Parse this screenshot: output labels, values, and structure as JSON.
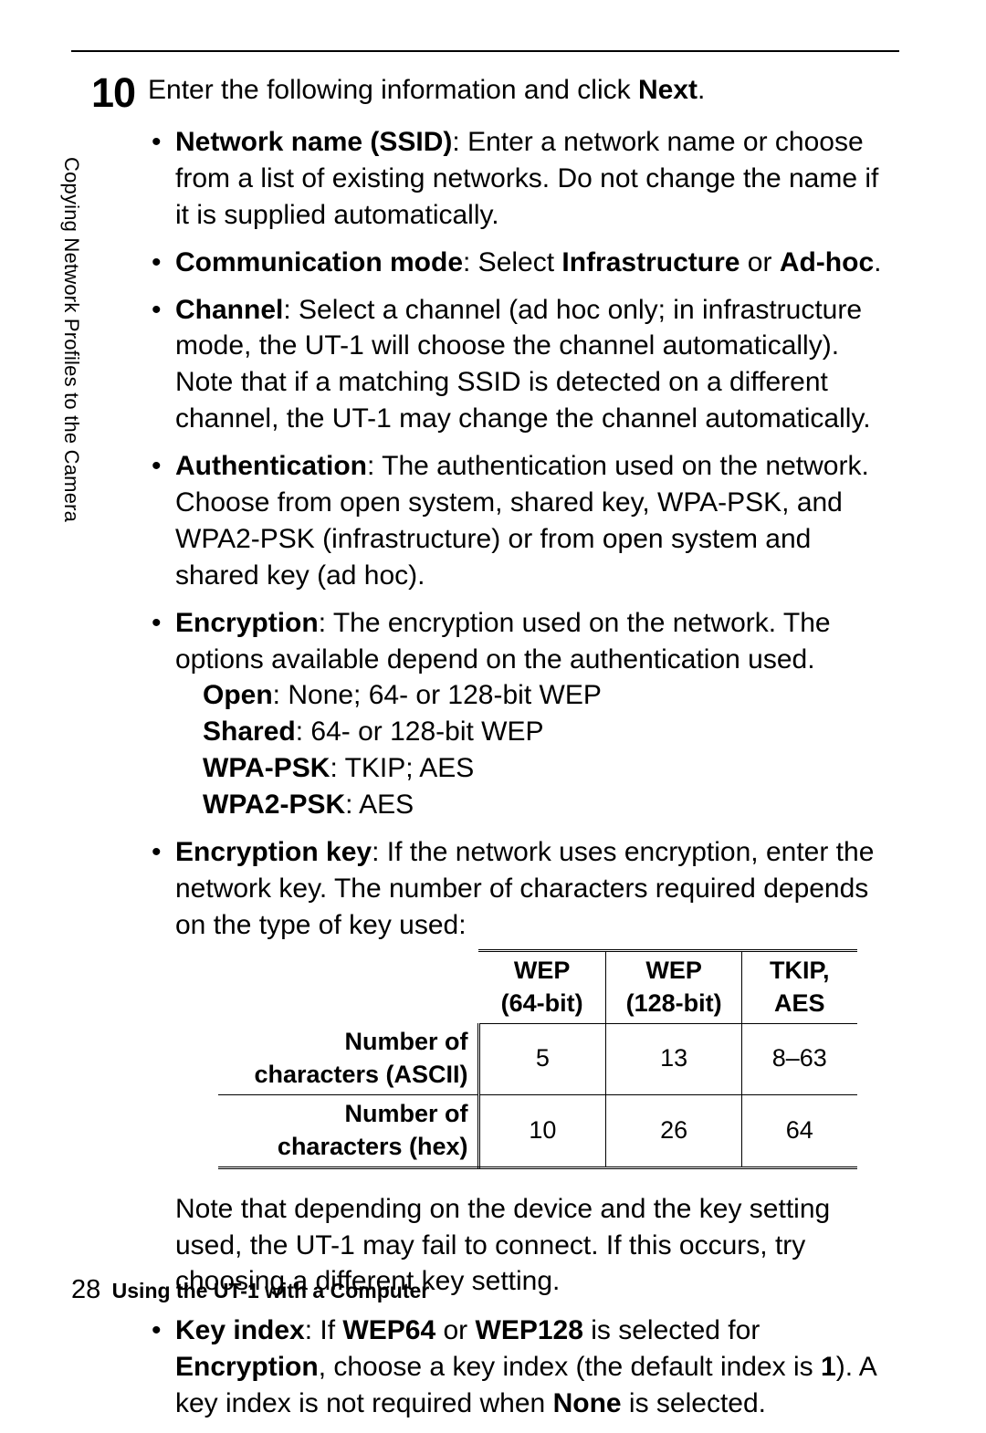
{
  "side_tab": "Copying Network Profiles to the Camera",
  "step_number": "10",
  "intro_pre": "Enter the following information and click ",
  "intro_bold": "Next",
  "intro_post": ".",
  "items": {
    "ssid": {
      "label": "Network name (SSID)",
      "text": ": Enter a network name or choose from a list of existing networks.  Do not change the name if it is supplied automatically."
    },
    "comm_mode": {
      "label": "Communication mode",
      "pre": ": Select ",
      "opt1": "Infrastructure",
      "mid": " or ",
      "opt2": "Ad-hoc",
      "post": "."
    },
    "channel": {
      "label": "Channel",
      "text": ": Select a channel (ad hoc only; in infrastructure mode, the UT-1 will choose the channel automatically). Note that if a matching SSID is detected on a different channel, the UT-1 may change the channel automatically."
    },
    "auth": {
      "label": "Authentication",
      "text": ": The authentication used on the network. Choose from open system, shared key, WPA-PSK, and WPA2-PSK (infrastructure) or from open system and shared key (ad hoc)."
    },
    "encryption": {
      "label": "Encryption",
      "text": ": The encryption used on the network. The options available depend on the authentication used.",
      "sub": {
        "open_l": "Open",
        "open_t": ": None; 64- or 128-bit WEP",
        "shared_l": "Shared",
        "shared_t": ": 64- or 128-bit WEP",
        "wpa_l": "WPA-PSK",
        "wpa_t": ": TKIP; AES",
        "wpa2_l": "WPA2-PSK",
        "wpa2_t": ": AES"
      }
    },
    "enckey": {
      "label": "Encryption key",
      "text": ": If the network uses encryption, enter the network key.  The number of characters required depends on the type of key used:"
    },
    "note_after": "Note that depending on the device and the key setting used, the UT-1 may fail to connect. If this occurs, try choosing a different key setting.",
    "keyindex": {
      "label": "Key index",
      "p1": ": If ",
      "w64": "WEP64",
      "p2": " or ",
      "w128": "WEP128",
      "p3": " is selected for ",
      "enc": "Encryption",
      "p4": ", choose a key index (the default index is ",
      "one": "1",
      "p5": "). A key index is not required when ",
      "none": "None",
      "p6": " is selected."
    }
  },
  "table": {
    "headers": {
      "c1": "WEP (64-bit)",
      "c2": "WEP (128-bit)",
      "c3": "TKIP, AES"
    },
    "rows": [
      {
        "label": "Number of characters (ASCII)",
        "c1": "5",
        "c2": "13",
        "c3": "8–63"
      },
      {
        "label": "Number of characters (hex)",
        "c1": "10",
        "c2": "26",
        "c3": "64"
      }
    ]
  },
  "footer": {
    "page": "28",
    "text": "Using the UT-1 with a Computer"
  }
}
